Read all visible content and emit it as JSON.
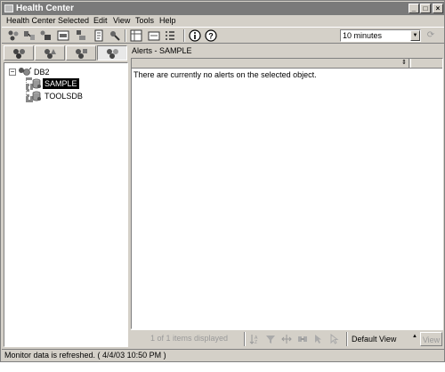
{
  "window": {
    "title": "Health Center",
    "controls": {
      "minimize": "_",
      "maximize": "□",
      "close": "×"
    }
  },
  "menubar": {
    "items": [
      {
        "label": "Health Center"
      },
      {
        "label": "Selected"
      },
      {
        "label": "Edit"
      },
      {
        "label": "View"
      },
      {
        "label": "Tools"
      },
      {
        "label": "Help"
      }
    ]
  },
  "toolbar": {
    "buttons": [
      {
        "icon": "control-center-icon"
      },
      {
        "icon": "replication-center-icon"
      },
      {
        "icon": "satellite-admin-center-icon"
      },
      {
        "icon": "command-center-icon"
      },
      {
        "icon": "task-center-icon"
      },
      {
        "icon": "journal-icon"
      },
      {
        "icon": "license-center-icon"
      },
      {
        "icon": "development-center-icon"
      },
      {
        "icon": "user-tools-icon"
      },
      {
        "icon": "contacts-icon"
      },
      {
        "icon": "tools-settings-icon"
      },
      {
        "icon": "info-icon"
      },
      {
        "icon": "help-icon"
      }
    ],
    "refresh_interval": "10 minutes"
  },
  "state_tabs": [
    {
      "icon": "alarm-state-icon",
      "active": false
    },
    {
      "icon": "warning-state-icon",
      "active": false
    },
    {
      "icon": "attention-state-icon",
      "active": false
    },
    {
      "icon": "normal-state-icon",
      "active": true
    }
  ],
  "tree": {
    "root": {
      "label": "DB2",
      "icon": "instance-icon",
      "expander": "−"
    },
    "children": [
      {
        "label": "SAMPLE",
        "icon": "database-icon",
        "selected": true
      },
      {
        "label": "TOOLSDB",
        "icon": "database-icon",
        "selected": false
      }
    ]
  },
  "alerts": {
    "title": "Alerts - SAMPLE",
    "sort_glyph": "⇕",
    "empty_message": "There are currently no alerts on the selected object.",
    "items_count": "1 of 1 items displayed",
    "view": "Default View",
    "view_button": "View"
  },
  "status": {
    "text": "Monitor data is refreshed. ( 4/4/03 10:50 PM )"
  }
}
